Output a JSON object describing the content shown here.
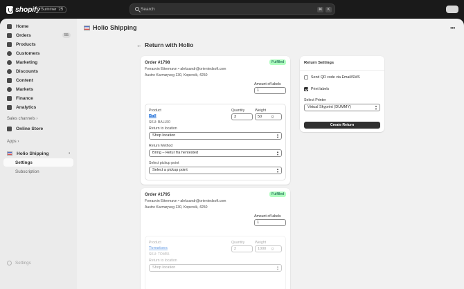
{
  "topbar": {
    "brand": "shopify",
    "edition": "Summer '25",
    "search_placeholder": "Search",
    "shortcut": [
      "⌘",
      "K"
    ]
  },
  "sidebar": {
    "items": [
      {
        "label": "Home",
        "icon": "home-icon"
      },
      {
        "label": "Orders",
        "icon": "orders-icon",
        "count": "55"
      },
      {
        "label": "Products",
        "icon": "tag-icon"
      },
      {
        "label": "Customers",
        "icon": "person-icon"
      },
      {
        "label": "Marketing",
        "icon": "target-icon"
      },
      {
        "label": "Discounts",
        "icon": "discount-icon"
      },
      {
        "label": "Content",
        "icon": "content-icon"
      },
      {
        "label": "Markets",
        "icon": "globe-icon"
      },
      {
        "label": "Finance",
        "icon": "bank-icon"
      },
      {
        "label": "Analytics",
        "icon": "chart-icon"
      }
    ],
    "sales_channels_label": "Sales channels",
    "online_store": "Online Store",
    "apps_label": "Apps",
    "app_name": "Holio Shipping",
    "app_sub": [
      "Settings",
      "Subscription"
    ],
    "settings_label": "Settings"
  },
  "header": {
    "title": "Holio Shipping",
    "more": "•••"
  },
  "page": {
    "title": "Return with Holio"
  },
  "orders": [
    {
      "title": "Order #1798",
      "status": "Fulfilled",
      "customer": "Forrasvin Ettermavn • aleksandr@orientedsoft.com",
      "address": "Austre Karmøyveg 130, Kopervik, 4250",
      "amount_label": "Amount of labels",
      "amount": "1",
      "product": {
        "product_label": "Product",
        "name": "Ball",
        "sku": "SKU: BALL50",
        "qty_label": "Quantity",
        "qty": "3",
        "weight_label": "Weight",
        "weight": "50",
        "unit": "g",
        "return_loc_label": "Return to location",
        "return_loc": "Shop location",
        "method_label": "Return Method",
        "method": "Bring – Retur fra hentested",
        "pickup_label": "Select pickup point",
        "pickup": "Select a pickup point"
      }
    },
    {
      "title": "Order #1795",
      "status": "Fulfilled",
      "customer": "Forrasvin Ettermavn • aleksandr@orientedsoft.com",
      "address": "Austre Karmøyveg 130, Kopervik, 4250",
      "amount_label": "Amount of labels",
      "amount": "1",
      "product": {
        "product_label": "Product",
        "name": "Tomatoes",
        "sku": "SKU: TOM55",
        "qty_label": "Quantity",
        "qty": "2",
        "weight_label": "Weight",
        "weight": "1000",
        "unit": "g",
        "return_loc_label": "Return to location",
        "return_loc": "Shop location"
      }
    }
  ],
  "return_settings": {
    "title": "Return Settings",
    "qr_label": "Send QR code via Email/SMS",
    "qr_checked": false,
    "print_label": "Print labels",
    "print_checked": true,
    "printer_label": "Select Printer",
    "printer": "Virtual Skyprint (DUMMY)",
    "create_button": "Create Return"
  }
}
